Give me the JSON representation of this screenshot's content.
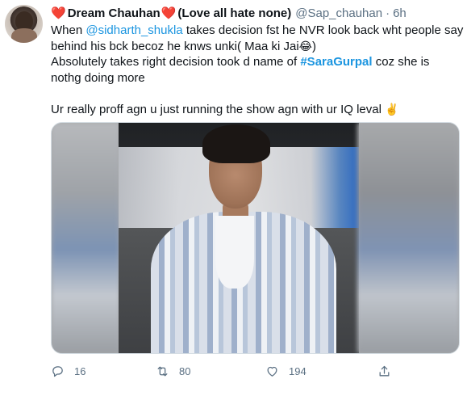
{
  "author": {
    "heart_left": "❤️",
    "name": "Dream Chauhan",
    "heart_right": "❤️",
    "motto": "(Love all hate none)",
    "handle": "@Sap_chauhan",
    "separator": "·",
    "time": "6h"
  },
  "tweet": {
    "line1_pre": "When ",
    "line1_mention": "@sidharth_shukla",
    "line1_post": " takes decision fst he NVR look back wht people say",
    "line2": "behind his bck becoz he knws unki( Maa ki Jai",
    "line2_emoji": "😂",
    "line2_end": ")",
    "line3_pre": "Absolutely takes right decision took d name of ",
    "line3_hashtag": "#SaraGurpal",
    "line3_post": " coz she is",
    "line4": "nothg doing more",
    "line6": "Ur really proff agn u just running the show agn with ur IQ leval ",
    "line6_emoji": "✌️"
  },
  "actions": {
    "replies": "16",
    "retweets": "80",
    "likes": "194",
    "reply_icon": "reply-icon",
    "retweet_icon": "retweet-icon",
    "like_icon": "heart-icon",
    "share_icon": "share-icon"
  },
  "colors": {
    "link": "#1b95e0",
    "secondary_text": "#5b7083",
    "heart": "#d0242f"
  }
}
